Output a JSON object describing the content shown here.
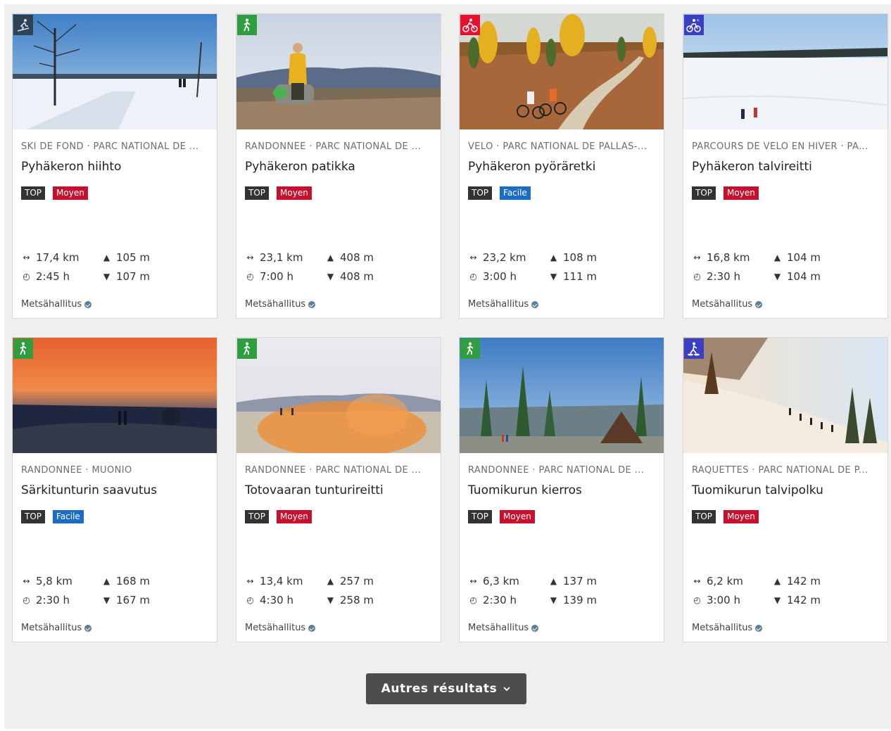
{
  "colors": {
    "top_tag": "#333333",
    "difficulty_moyen": "#c8102e",
    "difficulty_facile": "#1a6cc7",
    "activity_hiking": "#2e9e3e",
    "activity_cycling": "#e8102e",
    "activity_winter": "#3b3fc4",
    "button": "#4d4d4d"
  },
  "cards": [
    {
      "activity_icon": "cross-country-ski-icon",
      "category": "SKI DE FOND · PARC NATIONAL DE ...",
      "title": "Pyhäkeron hiihto",
      "top_label": "TOP",
      "difficulty": "Moyen",
      "distance": "17,4 km",
      "ascent": "105 m",
      "duration": "2:45 h",
      "descent": "107 m",
      "source": "Metsähallitus"
    },
    {
      "activity_icon": "hiking-icon",
      "category": "RANDONNÉE · PARC NATIONAL DE ...",
      "title": "Pyhäkeron patikka",
      "top_label": "TOP",
      "difficulty": "Moyen",
      "distance": "23,1 km",
      "ascent": "408 m",
      "duration": "7:00 h",
      "descent": "408 m",
      "source": "Metsähallitus"
    },
    {
      "activity_icon": "cycling-icon",
      "category": "VÉLO · PARC NATIONAL DE PALLAS-...",
      "title": "Pyhäkeron pyöräretki",
      "top_label": "TOP",
      "difficulty": "Facile",
      "distance": "23,2 km",
      "ascent": "108 m",
      "duration": "3:00 h",
      "descent": "111 m",
      "source": "Metsähallitus"
    },
    {
      "activity_icon": "winter-cycling-icon",
      "category": "PARCOURS DE VÉLO EN HIVER · PA...",
      "title": "Pyhäkeron talvireitti",
      "top_label": "TOP",
      "difficulty": "Moyen",
      "distance": "16,8 km",
      "ascent": "104 m",
      "duration": "2:30 h",
      "descent": "104 m",
      "source": "Metsähallitus"
    },
    {
      "activity_icon": "hiking-icon",
      "category": "RANDONNÉE · MUONIO",
      "title": "Särkitunturin saavutus",
      "top_label": "TOP",
      "difficulty": "Facile",
      "distance": "5,8 km",
      "ascent": "168 m",
      "duration": "2:30 h",
      "descent": "167 m",
      "source": "Metsähallitus"
    },
    {
      "activity_icon": "hiking-icon",
      "category": "RANDONNÉE · PARC NATIONAL DE ...",
      "title": "Totovaaran tunturireitti",
      "top_label": "TOP",
      "difficulty": "Moyen",
      "distance": "13,4 km",
      "ascent": "257 m",
      "duration": "4:30 h",
      "descent": "258 m",
      "source": "Metsähallitus"
    },
    {
      "activity_icon": "hiking-icon",
      "category": "RANDONNÉE · PARC NATIONAL DE ...",
      "title": "Tuomikurun kierros",
      "top_label": "TOP",
      "difficulty": "Moyen",
      "distance": "6,3 km",
      "ascent": "137 m",
      "duration": "2:30 h",
      "descent": "139 m",
      "source": "Metsähallitus"
    },
    {
      "activity_icon": "snowshoe-icon",
      "category": "RAQUETTES · PARC NATIONAL DE P...",
      "title": "Tuomikurun talvipolku",
      "top_label": "TOP",
      "difficulty": "Moyen",
      "distance": "6,2 km",
      "ascent": "142 m",
      "duration": "3:00 h",
      "descent": "142 m",
      "source": "Metsähallitus"
    }
  ],
  "more_button": {
    "label": "Autres résultats",
    "icon": "chevron-down-icon"
  }
}
